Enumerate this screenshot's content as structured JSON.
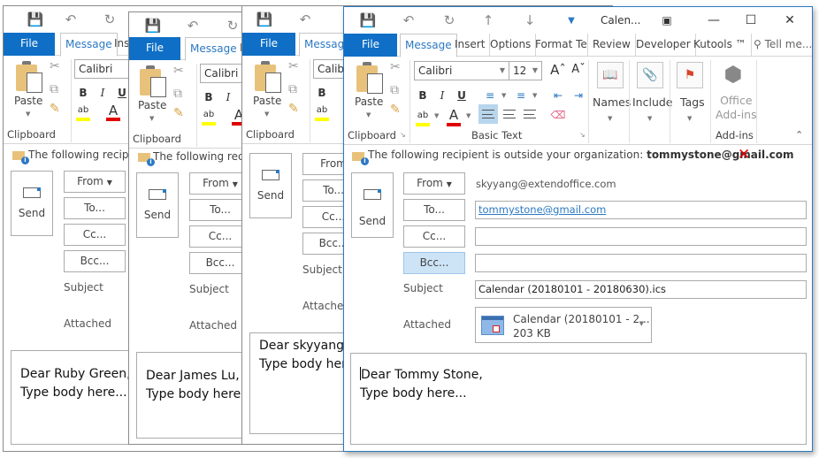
{
  "common": {
    "file_tab": "File",
    "message_tab": "Message",
    "insert_tab": "Insert",
    "font_name": "Calibri",
    "paste_label": "Paste",
    "clipboard_label": "Clipboard",
    "send_label": "Send",
    "from_label": "From",
    "to_label": "To...",
    "cc_label": "Cc...",
    "bcc_label": "Bcc...",
    "subject_label": "Subject",
    "attached_label": "Attached",
    "warning_prefix": "The following recipient is outside your organization:",
    "type_body": "Type body here..."
  },
  "background_windows": [
    {
      "greeting": "Dear Ruby Green,"
    },
    {
      "greeting": "Dear James Lu,"
    },
    {
      "greeting": "Dear skyyang,"
    }
  ],
  "active_window": {
    "title": "Calen...",
    "tabs": [
      "File",
      "Message",
      "Insert",
      "Options",
      "Format Tex",
      "Review",
      "Developer",
      "Kutools ™",
      "Tell me..."
    ],
    "selected_tab": "Message",
    "ribbon": {
      "font_name": "Calibri",
      "font_size": "12",
      "groups": {
        "clipboard": "Clipboard",
        "basic_text": "Basic Text",
        "addins": "Add-ins"
      },
      "buttons": {
        "paste": "Paste",
        "names": "Names",
        "include": "Include",
        "tags": "Tags",
        "office_addins_line1": "Office",
        "office_addins_line2": "Add-ins"
      },
      "colors": {
        "highlight": "#ffff00",
        "font_color": "#e00000",
        "accent": "#0f6fc6"
      }
    },
    "warning": {
      "text": "The following recipient is outside your organization:",
      "email": "tommystone@gmail.com"
    },
    "compose": {
      "send": "Send",
      "from_button": "From",
      "from_value": "skyyang@extendoffice.com",
      "to_button": "To...",
      "to_value": "tommystone@gmail.com",
      "cc_button": "Cc...",
      "cc_value": "",
      "bcc_button": "Bcc...",
      "bcc_value": "",
      "subject_label": "Subject",
      "subject_value": "Calendar (20180101 - 20180630).ics",
      "attached_label": "Attached",
      "attachment_name": "Calendar (20180101 - 2...",
      "attachment_size": "203 KB"
    },
    "body": {
      "greeting": "Dear Tommy Stone,",
      "line2": "Type body here..."
    }
  }
}
